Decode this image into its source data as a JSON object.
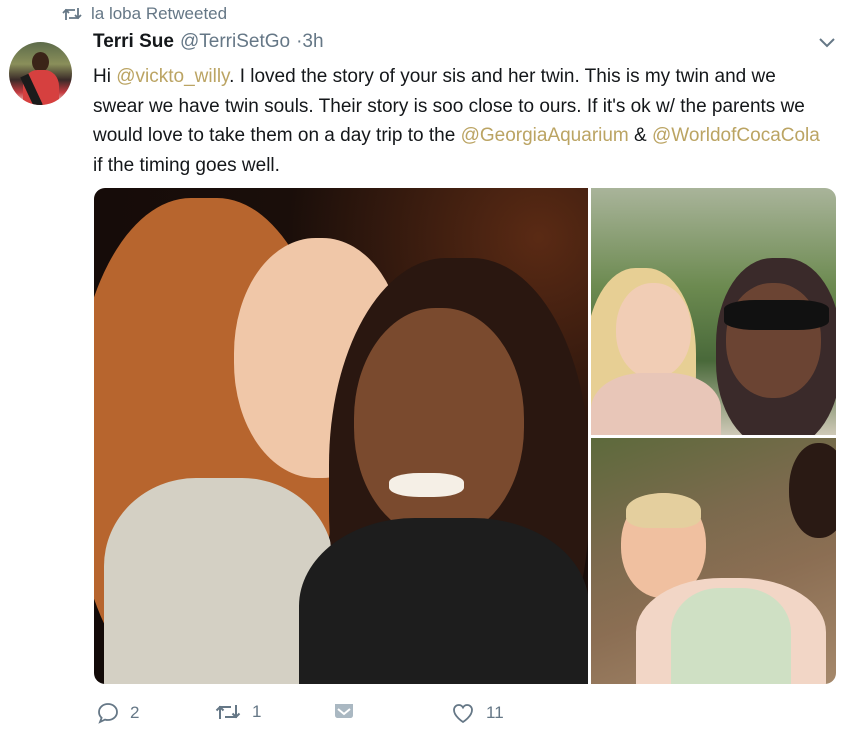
{
  "retweet": {
    "label": "la loba Retweeted",
    "icon": "retweet-icon"
  },
  "tweet": {
    "author": {
      "name": "Terri Sue",
      "handle": "@TerriSetGo",
      "time": "·3h"
    },
    "text": {
      "part1": "Hi ",
      "mention1": "@vickto_willy",
      "part2": ". I loved the story of your sis and her twin. This is my twin and we swear we have twin souls. Their story is soo close to ours. If it's ok w/ the parents we would love to take them on a day trip to the ",
      "mention2": "@GeorgiaAquarium",
      "part3": " & ",
      "mention3": "@WorldofCocaCola",
      "part4": " if the timing goes well."
    },
    "media_count": 3
  },
  "actions": {
    "reply": {
      "count": "2",
      "icon": "reply-icon"
    },
    "retweet": {
      "count": "1",
      "icon": "retweet-icon"
    },
    "dm": {
      "icon": "direct-message-icon"
    },
    "like": {
      "count": "11",
      "icon": "heart-icon"
    }
  },
  "colors": {
    "mention": "#bba463",
    "secondary_text": "#657786",
    "primary_text": "#14171a"
  }
}
